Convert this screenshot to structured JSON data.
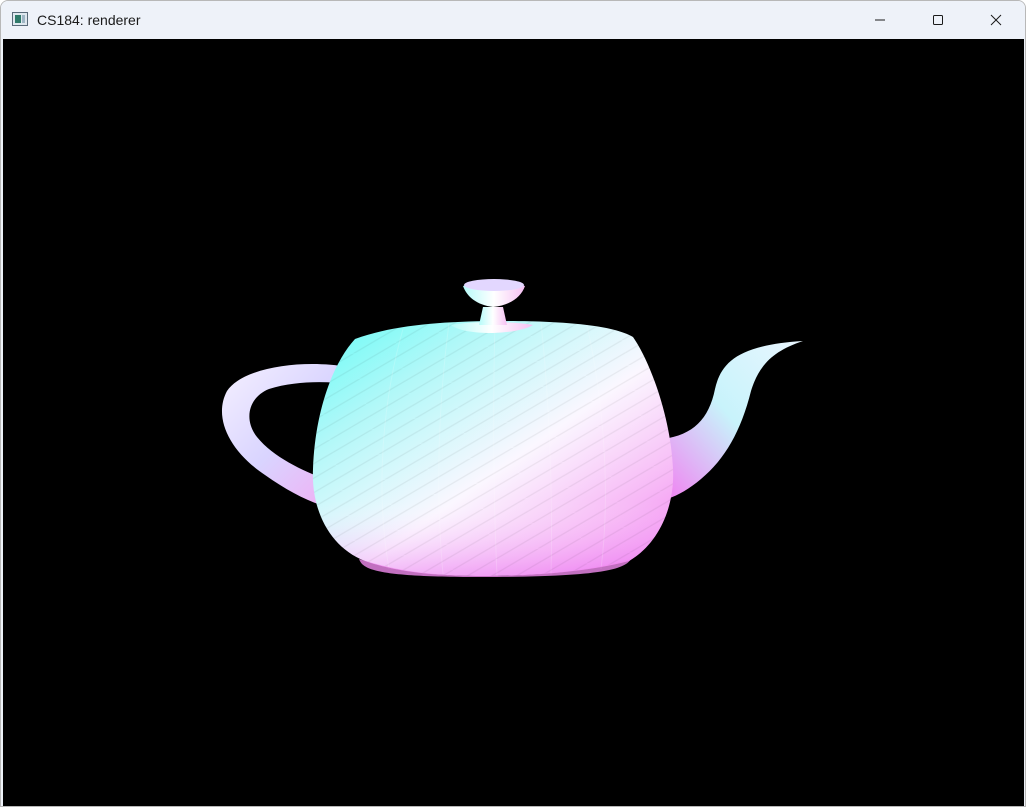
{
  "window": {
    "title": "CS184: renderer",
    "app_icon": "app-window-icon",
    "controls": {
      "minimize_icon": "minimize-icon",
      "maximize_icon": "maximize-icon",
      "close_icon": "close-icon"
    }
  },
  "viewport": {
    "background_color": "#000000",
    "object": "teapot-mesh",
    "shading_colors": {
      "cyan": "#5ffcf6",
      "white": "#fbf7ff",
      "magenta": "#f07bf1"
    }
  }
}
